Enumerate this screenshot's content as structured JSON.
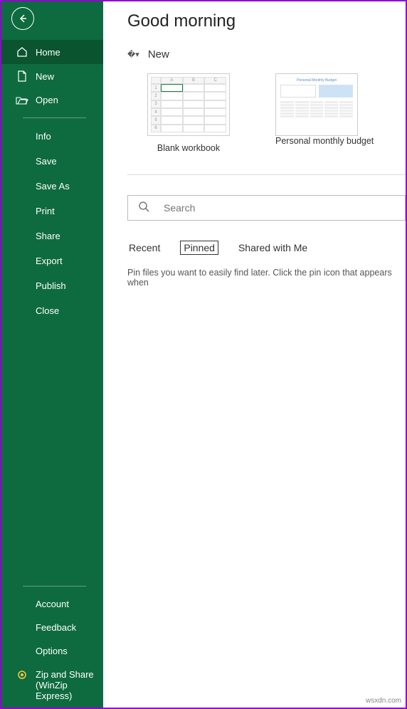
{
  "header": {
    "title": "Good morning"
  },
  "sidebar": {
    "back_aria": "Back",
    "primary": [
      {
        "label": "Home",
        "icon": "home"
      },
      {
        "label": "New",
        "icon": "document"
      },
      {
        "label": "Open",
        "icon": "folder"
      }
    ],
    "secondary": [
      {
        "label": "Info"
      },
      {
        "label": "Save"
      },
      {
        "label": "Save As"
      },
      {
        "label": "Print"
      },
      {
        "label": "Share"
      },
      {
        "label": "Export"
      },
      {
        "label": "Publish"
      },
      {
        "label": "Close"
      }
    ],
    "footer": [
      {
        "label": "Account"
      },
      {
        "label": "Feedback"
      },
      {
        "label": "Options"
      }
    ],
    "zip": {
      "line1": "Zip and Share",
      "line2": "(WinZip",
      "line3": "Express)"
    }
  },
  "new_section": {
    "heading": "New",
    "templates": [
      {
        "label": "Blank workbook",
        "cols": [
          "A",
          "B",
          "C"
        ],
        "rows": [
          "1",
          "2",
          "3",
          "4",
          "5",
          "6"
        ]
      },
      {
        "label": "Personal monthly budget",
        "title": "Personal Monthly Budget"
      }
    ]
  },
  "search": {
    "placeholder": "Search"
  },
  "tabs": {
    "items": [
      "Recent",
      "Pinned",
      "Shared with Me"
    ],
    "selected": "Pinned"
  },
  "hint": "Pin files you want to easily find later. Click the pin icon that appears when",
  "watermark": "wsxdn.com"
}
